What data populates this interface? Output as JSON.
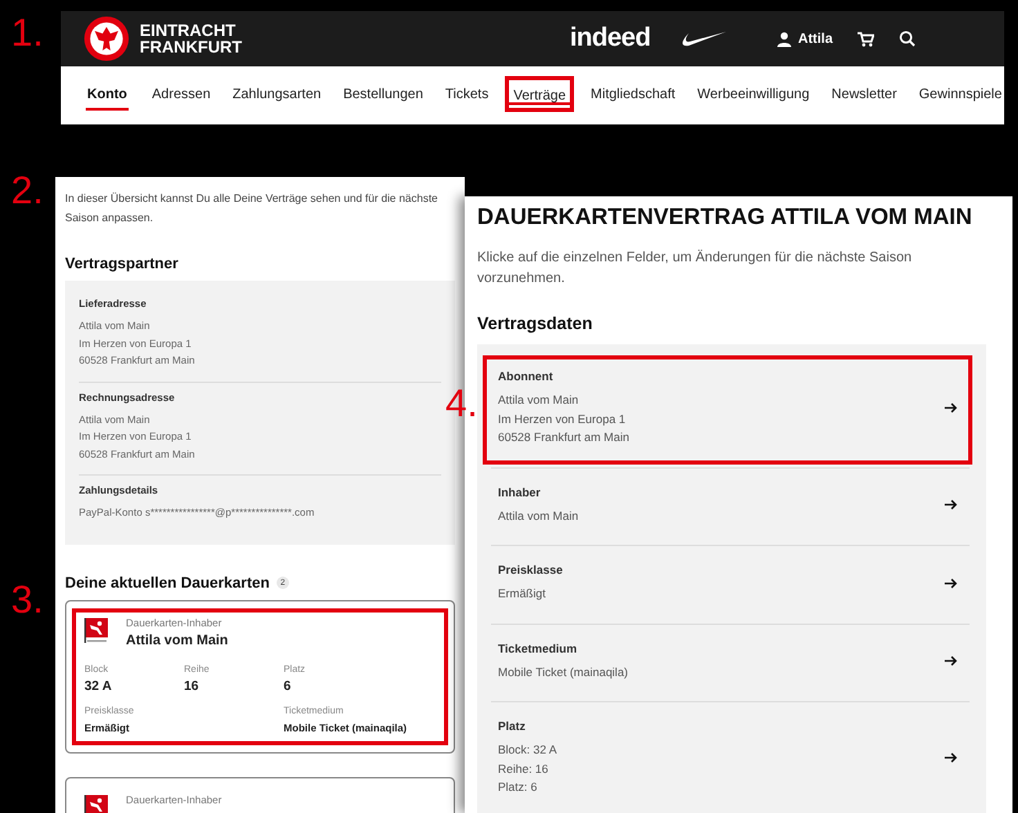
{
  "steps": [
    "1.",
    "2.",
    "3.",
    "4."
  ],
  "header": {
    "brand_line_1": "EINTRACHT",
    "brand_line_2": "FRANKFURT",
    "sponsor": "indeed",
    "user": "Attila"
  },
  "nav": [
    {
      "label": "Konto",
      "kind": "root",
      "selected": true,
      "highlighted": false
    },
    {
      "label": "Adressen",
      "kind": "tab",
      "selected": false,
      "highlighted": false
    },
    {
      "label": "Zahlungsarten",
      "kind": "tab",
      "selected": false,
      "highlighted": false
    },
    {
      "label": "Bestellungen",
      "kind": "tab",
      "selected": false,
      "highlighted": false
    },
    {
      "label": "Tickets",
      "kind": "tab",
      "selected": false,
      "highlighted": false
    },
    {
      "label": "Verträge",
      "kind": "tab",
      "selected": true,
      "highlighted": true
    },
    {
      "label": "Mitgliedschaft",
      "kind": "tab",
      "selected": false,
      "highlighted": false
    },
    {
      "label": "Werbeeinwilligung",
      "kind": "tab",
      "selected": false,
      "highlighted": false
    },
    {
      "label": "Newsletter",
      "kind": "tab",
      "selected": false,
      "highlighted": false
    },
    {
      "label": "Gewinnspiele",
      "kind": "tab",
      "selected": false,
      "highlighted": false
    }
  ],
  "overview": {
    "intro": "In dieser Übersicht kannst Du alle Deine Verträge sehen und für die nächste Saison anpassen.",
    "partner_heading": "Vertragspartner",
    "partner_sections": [
      {
        "label": "Lieferadresse",
        "lines": [
          "Attila vom Main",
          "Im Herzen von Europa 1",
          "60528 Frankfurt am Main"
        ]
      },
      {
        "label": "Rechnungsadresse",
        "lines": [
          "Attila vom Main",
          "Im Herzen von Europa 1",
          "60528 Frankfurt am Main"
        ]
      },
      {
        "label": "Zahlungsdetails",
        "lines": [
          "PayPal-Konto s****************@p***************.com"
        ]
      }
    ],
    "cards_heading": "Deine aktuellen Dauerkarten",
    "cards_count": "2",
    "cards": [
      {
        "caption": "Dauerkarten-Inhaber",
        "holder": "Attila vom Main",
        "highlighted": true,
        "fields": [
          {
            "label": "Block",
            "value": "32 A"
          },
          {
            "label": "Reihe",
            "value": "16"
          },
          {
            "label": "Platz",
            "value": "6"
          }
        ],
        "details": [
          {
            "label": "Preisklasse",
            "value": "Ermäßigt"
          },
          {
            "label": "Ticketmedium",
            "value": "Mobile Ticket (mainaqila)"
          }
        ]
      },
      {
        "caption": "Dauerkarten-Inhaber",
        "highlighted": false
      }
    ]
  },
  "contract": {
    "title": "DAUERKARTENVERTRAG ATTILA VOM MAIN",
    "intro": "Klicke auf die einzelnen Felder, um Änderungen für die nächste Saison vorzunehmen.",
    "heading": "Vertragsdaten",
    "rows": [
      {
        "label": "Abonnent",
        "lines": [
          "Attila vom Main",
          "Im Herzen von Europa 1",
          "60528 Frankfurt am Main"
        ],
        "highlighted": true
      },
      {
        "label": "Inhaber",
        "lines": [
          "Attila vom Main"
        ],
        "highlighted": false
      },
      {
        "label": "Preisklasse",
        "lines": [
          "Ermäßigt"
        ],
        "highlighted": false
      },
      {
        "label": "Ticketmedium",
        "lines": [
          "Mobile Ticket (mainaqila)"
        ],
        "highlighted": false
      },
      {
        "label": "Platz",
        "lines": [
          "Block: 32 A",
          "Reihe: 16",
          "Platz: 6"
        ],
        "highlighted": false
      }
    ]
  }
}
